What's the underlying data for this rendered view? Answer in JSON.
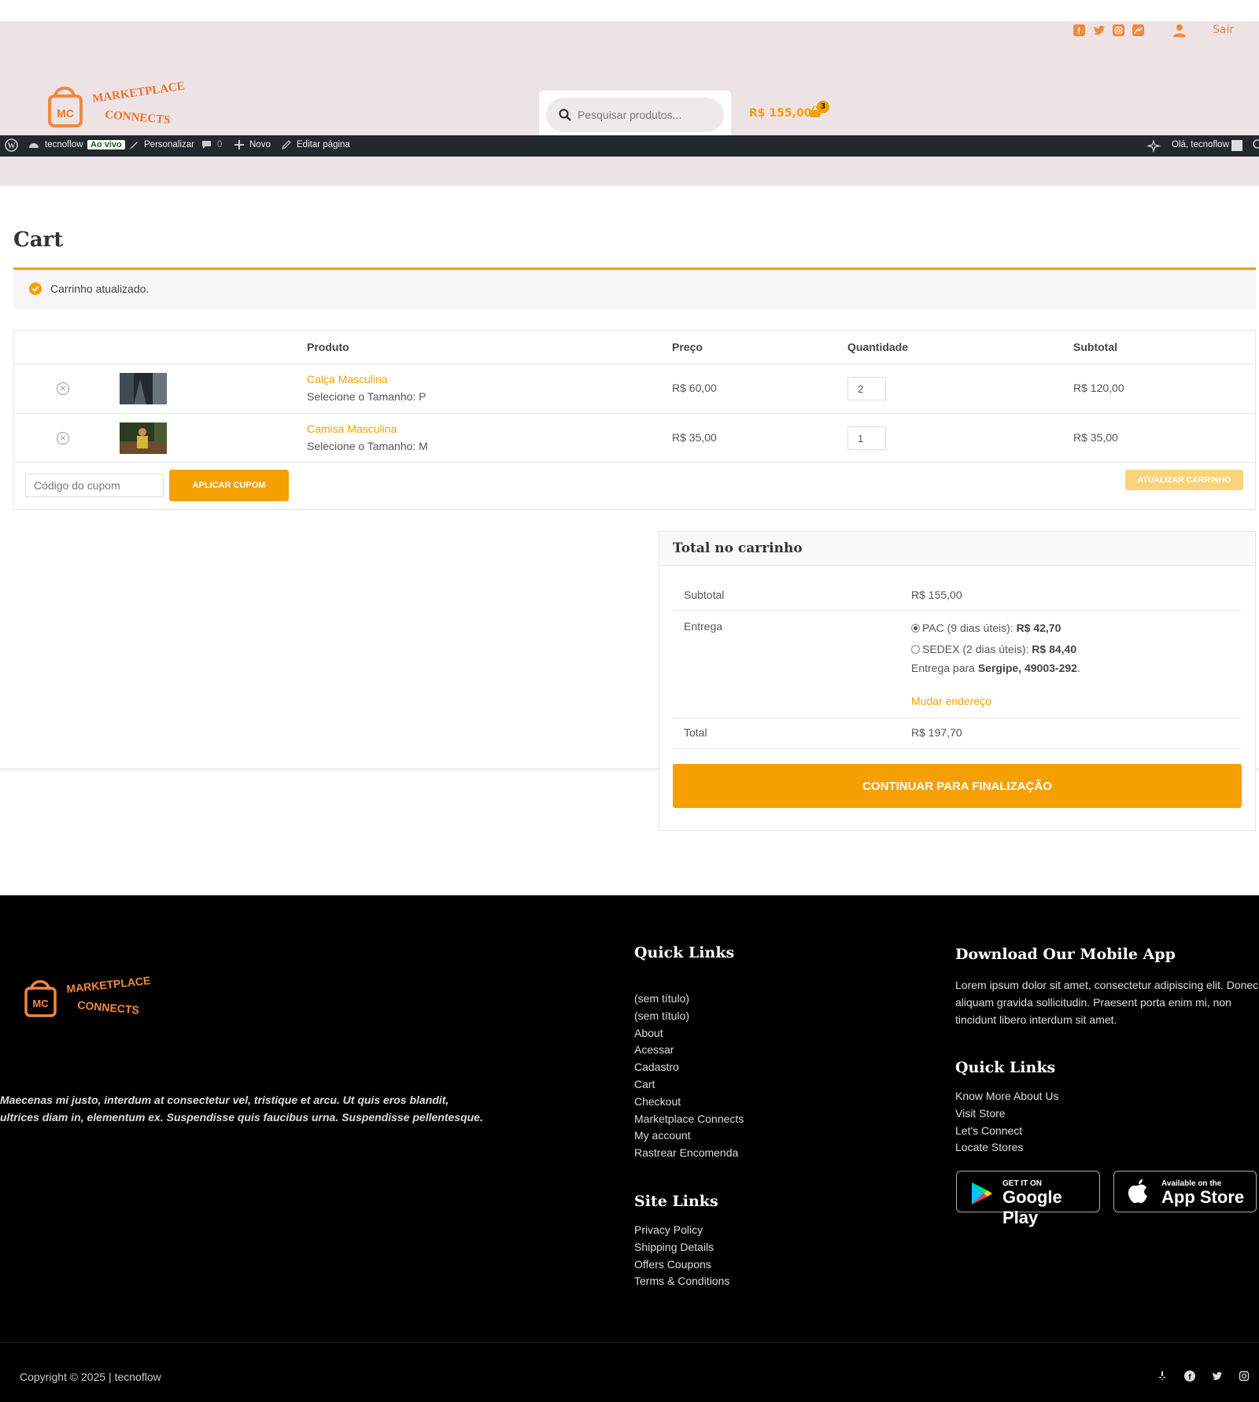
{
  "header": {
    "social_icons": [
      "facebook-icon",
      "twitter-icon",
      "instagram-icon",
      "flickr-icon"
    ],
    "account_icon": "user-icon",
    "logout_label": "Sair",
    "logo": {
      "mark": "MC",
      "line1": "MARKETPLACE",
      "line2": "CONNECTS"
    },
    "search_placeholder": "Pesquisar produtos...",
    "cart_amount": "R$ 155,00",
    "cart_count": "3",
    "accent": "#f5a000"
  },
  "adminbar": {
    "site_name": "tecnoflow",
    "live_badge": "Ao vivo",
    "customize": "Personalizar",
    "comments": "0",
    "new": "Novo",
    "edit_page": "Editar página",
    "greeting": "Olá, tecnoflow"
  },
  "cart": {
    "title": "Cart",
    "notice": "Carrinho atualizado.",
    "columns": {
      "product": "Produto",
      "price": "Preço",
      "quantity": "Quantidade",
      "subtotal": "Subtotal"
    },
    "items": [
      {
        "name": "Calça Masculina",
        "variation": "Selecione o Tamanho: P",
        "price": "R$ 60,00",
        "qty": "2",
        "subtotal": "R$ 120,00"
      },
      {
        "name": "Camisa Masculina",
        "variation": "Selecione o Tamanho: M",
        "price": "R$ 35,00",
        "qty": "1",
        "subtotal": "R$ 35,00"
      }
    ],
    "coupon_placeholder": "Código do cupom",
    "apply_label": "APLICAR CUPOM",
    "update_label": "ATUALIZAR CARRINHO"
  },
  "totals": {
    "title": "Total no carrinho",
    "subtotal_label": "Subtotal",
    "subtotal_value": "R$ 155,00",
    "shipping_label": "Entrega",
    "option1_label": "PAC (9 dias úteis): ",
    "option1_price": "R$ 42,70",
    "option2_label": "SEDEX (2 dias úteis): ",
    "option2_price": "R$ 84,40",
    "dest_prefix": "Entrega para ",
    "dest_value": "Sergipe, 49003-292",
    "dest_suffix": ".",
    "change_address": "Mudar endereço",
    "total_label": "Total",
    "total_value": "R$ 197,70",
    "checkout_label": "CONTINUAR PARA FINALIZAÇÃO"
  },
  "footer": {
    "description": "Maecenas mi justo, interdum at consectetur vel, tristique et arcu. Ut quis eros blandit, ultrices diam in, elementum ex. Suspendisse quis faucibus urna. Suspendisse pellentesque.",
    "quick_links_title": "Quick Links",
    "quick_links": [
      "(sem título)",
      "(sem título)",
      "About",
      "Acessar",
      "Cadastro",
      "Cart",
      "Checkout",
      "Marketplace Connects",
      "My account",
      "Rastrear Encomenda"
    ],
    "site_links_title": "Site Links",
    "site_links": [
      "Privacy Policy",
      "Shipping Details",
      "Offers Coupons",
      "Terms & Conditions"
    ],
    "app_title": "Download Our Mobile App",
    "app_description": "Lorem ipsum dolor sit amet, consectetur adipiscing elit. Donec aliquam gravida sollicitudin. Praesent porta enim mi, non tincidunt libero interdum sit amet.",
    "quick_links2_title": "Quick Links",
    "quick_links2": [
      "Know More About Us",
      "Visit Store",
      "Let's Connect",
      "Locate Stores"
    ],
    "google_small": "GET IT ON",
    "google_big": "Google Play",
    "apple_small": "Available on the",
    "apple_big": "App Store",
    "copyright": "Copyright © 2025 | tecnoflow"
  }
}
